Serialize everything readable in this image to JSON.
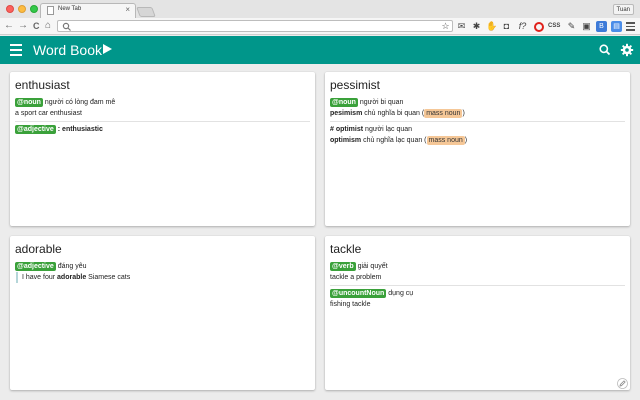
{
  "browser": {
    "tab_title": "New Tab",
    "tab_close": "×",
    "profile_name": "Tuan",
    "back": "←",
    "forward": "→",
    "reload": "C",
    "home": "⌂",
    "url": "",
    "extensions": [
      {
        "icon": "star-icon",
        "glyph": "☆"
      },
      {
        "icon": "mail-icon",
        "glyph": "✉"
      },
      {
        "icon": "puzzle-icon",
        "glyph": "✱"
      },
      {
        "icon": "hand-icon",
        "glyph": "✋"
      },
      {
        "icon": "pocket-icon",
        "glyph": "◘"
      },
      {
        "icon": "function-icon",
        "glyph": "f?"
      },
      {
        "icon": "opera-icon",
        "glyph": ""
      },
      {
        "icon": "css-icon",
        "glyph": "CSS"
      },
      {
        "icon": "eyedropper-icon",
        "glyph": "✎"
      },
      {
        "icon": "save-icon",
        "glyph": "▣"
      },
      {
        "icon": "b-extension-icon",
        "glyph": "B"
      },
      {
        "icon": "screen-icon",
        "glyph": "▤"
      }
    ]
  },
  "app": {
    "title": "Word Book",
    "accent": "#00968a",
    "pos_color": "#3aa13a",
    "tag_color": "#f5c797"
  },
  "cards": [
    {
      "word": "enthusiast",
      "s1": {
        "pos": "@noun",
        "meaning": "người có lòng đam mê",
        "example": "a sport car enthusiast"
      },
      "s2": {
        "pos": "@adjective",
        "sep": ":",
        "related": "enthusiastic"
      }
    },
    {
      "word": "pessimist",
      "s1": {
        "pos": "@noun",
        "meaning": "người bi quan",
        "term": "pesimism",
        "term_meaning": "chủ nghĩa bi quan (",
        "tag": "mass noun",
        "close": ")"
      },
      "s2": {
        "prefix": "#",
        "term1": "optimist",
        "meaning1": "người lạc quan",
        "term2": "optimism",
        "meaning2": "chủ nghĩa lạc quan (",
        "tag": "mass noun",
        "close": ")"
      }
    },
    {
      "word": "adorable",
      "s1": {
        "pos": "@adjective",
        "meaning": "đáng yêu",
        "ex_before": "I have four",
        "ex_bold": "adorable",
        "ex_after": "Siamese cats"
      }
    },
    {
      "word": "tackle",
      "s1": {
        "pos": "@verb",
        "meaning": "giải quyết",
        "example": "tackle a problem"
      },
      "s2": {
        "pos": "@uncountNoun",
        "meaning": "dụng cụ",
        "example": "fishing tackle"
      }
    }
  ]
}
